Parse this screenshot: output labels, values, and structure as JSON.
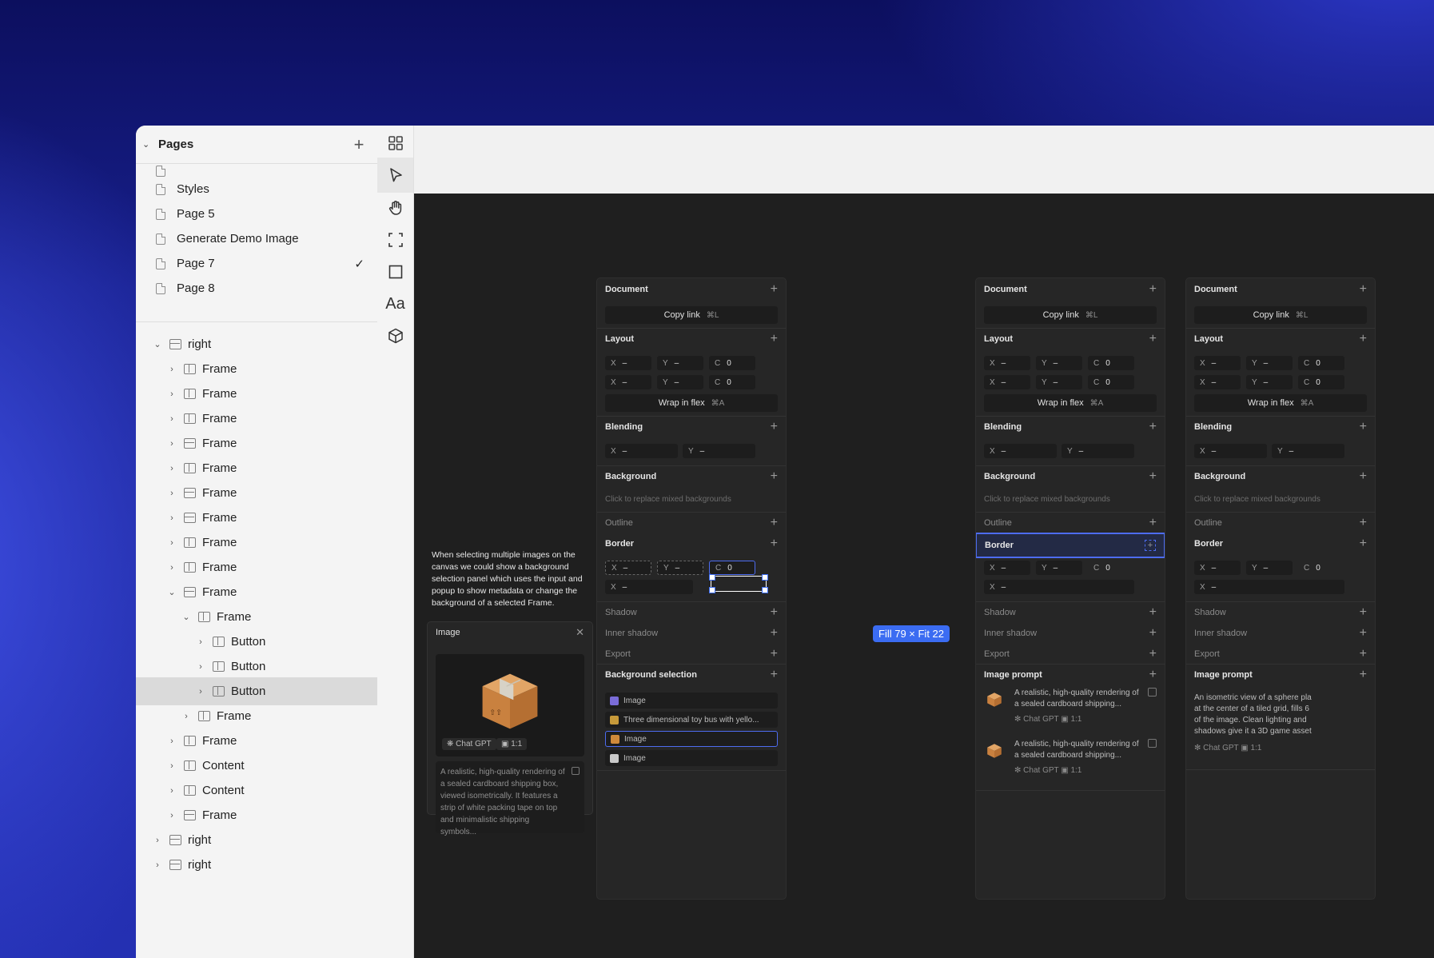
{
  "left_panel": {
    "pages_title": "Pages",
    "pages": [
      {
        "label": "Styles"
      },
      {
        "label": "Page 5"
      },
      {
        "label": "Generate Demo Image"
      },
      {
        "label": "Page 7",
        "current": true
      },
      {
        "label": "Page 8"
      }
    ],
    "layers": [
      {
        "label": "right",
        "indent": 0,
        "icon": "h",
        "expanded": true
      },
      {
        "label": "Frame",
        "indent": 1,
        "icon": "v"
      },
      {
        "label": "Frame",
        "indent": 1,
        "icon": "v"
      },
      {
        "label": "Frame",
        "indent": 1,
        "icon": "v"
      },
      {
        "label": "Frame",
        "indent": 1,
        "icon": "h"
      },
      {
        "label": "Frame",
        "indent": 1,
        "icon": "v"
      },
      {
        "label": "Frame",
        "indent": 1,
        "icon": "h"
      },
      {
        "label": "Frame",
        "indent": 1,
        "icon": "h"
      },
      {
        "label": "Frame",
        "indent": 1,
        "icon": "v"
      },
      {
        "label": "Frame",
        "indent": 1,
        "icon": "v"
      },
      {
        "label": "Frame",
        "indent": 1,
        "icon": "h",
        "expanded": true
      },
      {
        "label": "Frame",
        "indent": 2,
        "icon": "v",
        "expanded": true
      },
      {
        "label": "Button",
        "indent": 3,
        "icon": "v"
      },
      {
        "label": "Button",
        "indent": 3,
        "icon": "v"
      },
      {
        "label": "Button",
        "indent": 3,
        "icon": "v",
        "selected": true
      },
      {
        "label": "Frame",
        "indent": 2,
        "icon": "v"
      },
      {
        "label": "Frame",
        "indent": 1,
        "icon": "v"
      },
      {
        "label": "Content",
        "indent": 1,
        "icon": "v"
      },
      {
        "label": "Content",
        "indent": 1,
        "icon": "v"
      },
      {
        "label": "Frame",
        "indent": 1,
        "icon": "h"
      },
      {
        "label": "right",
        "indent": 0,
        "icon": "h"
      },
      {
        "label": "right",
        "indent": 0,
        "icon": "h"
      }
    ]
  },
  "toolbar": {
    "icons": [
      "components-icon",
      "pointer-icon",
      "hand-icon",
      "frame-icon",
      "rectangle-icon",
      "text-icon",
      "3d-icon"
    ],
    "text_tool": "Aa"
  },
  "canvas": {
    "note": "When selecting multiple images on the canvas we could show a background selection panel which uses the input and popup to show metadata or change the background of a selected Frame.",
    "image_card": {
      "title": "Image",
      "chip_model": "Chat GPT",
      "chip_ratio": "1:1",
      "description": "A realistic, high-quality rendering of a sealed cardboard shipping box, viewed isometrically. It features a strip of white packing tape on top and minimalistic shipping symbols..."
    },
    "tooltip": "Fill 79 × Fit 22",
    "labels": {
      "document": "Document",
      "copy_link": "Copy link",
      "copy_link_key": "⌘L",
      "layout": "Layout",
      "wrap_flex": "Wrap in flex",
      "wrap_flex_key": "⌘A",
      "blending": "Blending",
      "background": "Background",
      "bg_placeholder": "Click to replace mixed backgrounds",
      "outline": "Outline",
      "border": "Border",
      "shadow": "Shadow",
      "inner_shadow": "Inner shadow",
      "export": "Export",
      "background_selection": "Background selection",
      "image_prompt": "Image prompt",
      "x": "X",
      "y": "Y",
      "c": "C",
      "dash": "–",
      "zero": "0"
    },
    "bg_selection_items": [
      {
        "label": "Image"
      },
      {
        "label": "Three dimensional toy bus with yello..."
      },
      {
        "label": "Image",
        "selected": true
      },
      {
        "label": "Image"
      }
    ],
    "prompts": [
      {
        "text": "A realistic, high-quality rendering of a sealed cardboard shipping...",
        "model": "Chat GPT",
        "ratio": "1:1"
      },
      {
        "text": "A realistic, high-quality rendering of a sealed cardboard shipping...",
        "model": "Chat GPT",
        "ratio": "1:1"
      }
    ],
    "prompt3": {
      "text": "An isometric view of a sphere pla at the center of a tiled grid, fills 6 of the image. Clean lighting and shadows give it a 3D game asset",
      "model": "Chat GPT",
      "ratio": "1:1"
    }
  }
}
